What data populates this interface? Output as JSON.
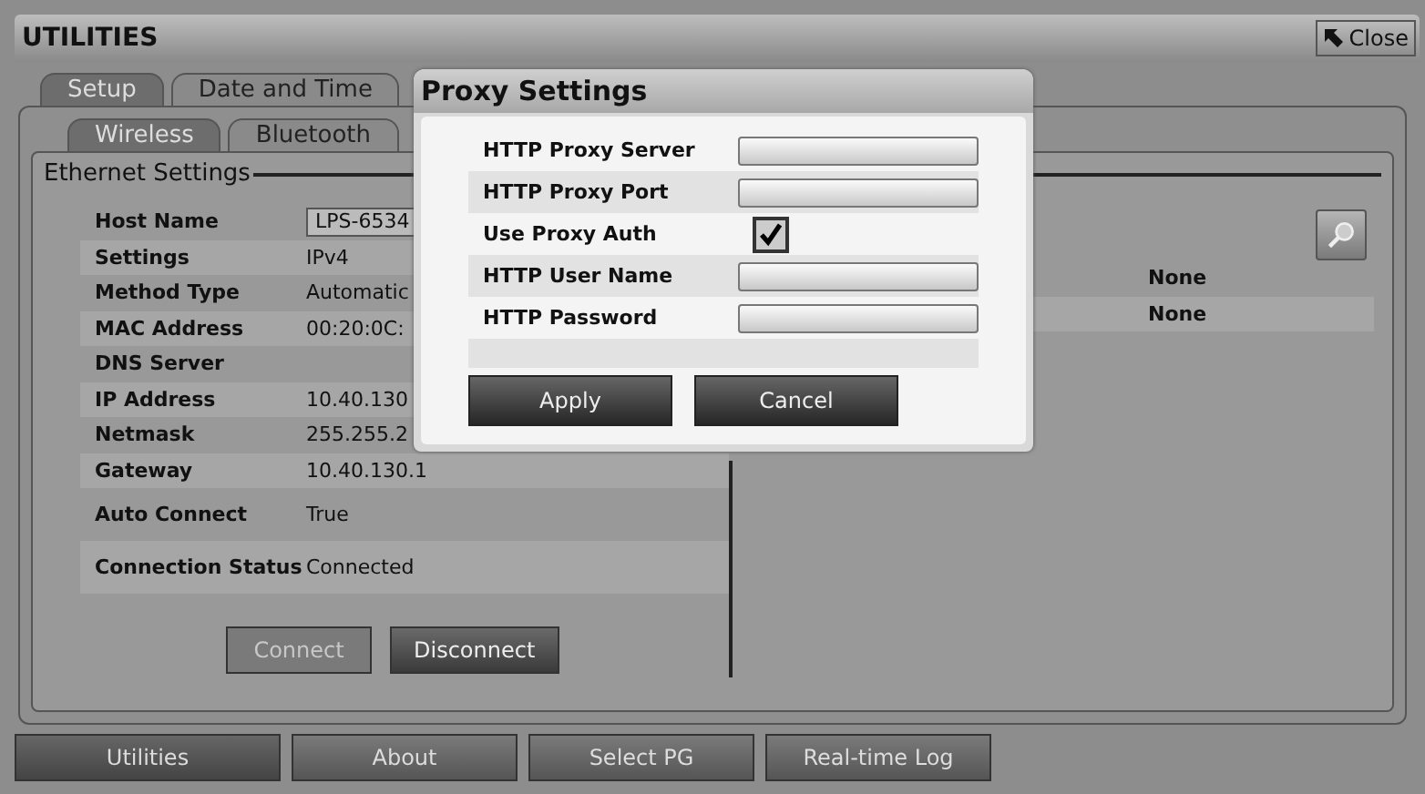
{
  "window": {
    "title": "UTILITIES",
    "close_button": "Close"
  },
  "tabs": [
    {
      "label": "Setup",
      "selected": true
    },
    {
      "label": "Date and Time",
      "selected": false
    }
  ],
  "subtabs": [
    {
      "label": "Wireless",
      "selected": true
    },
    {
      "label": "Bluetooth",
      "selected": false
    }
  ],
  "ethernet": {
    "title": "Ethernet Settings",
    "rows": [
      {
        "label": "Host Name",
        "value": "LPS-6534",
        "kind": "field"
      },
      {
        "label": "Settings",
        "value": "IPv4",
        "kind": "text"
      },
      {
        "label": "Method Type",
        "value": "Automatic",
        "kind": "text"
      },
      {
        "label": "MAC Address",
        "value": "00:20:0C:",
        "kind": "text"
      },
      {
        "label": "DNS Server",
        "kind": "text"
      },
      {
        "label": "IP Address",
        "value": "10.40.130",
        "kind": "text"
      },
      {
        "label": "Netmask",
        "value": "255.255.2",
        "kind": "text"
      },
      {
        "label": "Gateway",
        "value": "10.40.130.1",
        "kind": "text"
      },
      {
        "label": "Auto Connect",
        "value": "True",
        "kind": "text"
      },
      {
        "label": "Connection Status",
        "value": "Connected",
        "kind": "text"
      }
    ],
    "buttons": [
      {
        "label": "Connect",
        "disabled": true
      },
      {
        "label": "Disconnect",
        "disabled": false
      }
    ],
    "right_rows": [
      "None",
      "None"
    ]
  },
  "proxy_dialog": {
    "title": "Proxy Settings",
    "fields": [
      {
        "label": "HTTP Proxy Server",
        "kind": "input"
      },
      {
        "label": "HTTP Proxy Port",
        "kind": "input"
      },
      {
        "label": "Use Proxy Auth",
        "kind": "checkbox",
        "checked": true
      },
      {
        "label": "HTTP User Name",
        "kind": "input"
      },
      {
        "label": "HTTP Password",
        "kind": "input"
      }
    ],
    "buttons": [
      "Apply",
      "Cancel"
    ]
  },
  "bottom_nav": [
    {
      "label": "Utilities",
      "selected": true
    },
    {
      "label": "About",
      "selected": false
    },
    {
      "label": "Select PG",
      "selected": false
    },
    {
      "label": "Real-time Log",
      "selected": false
    }
  ]
}
